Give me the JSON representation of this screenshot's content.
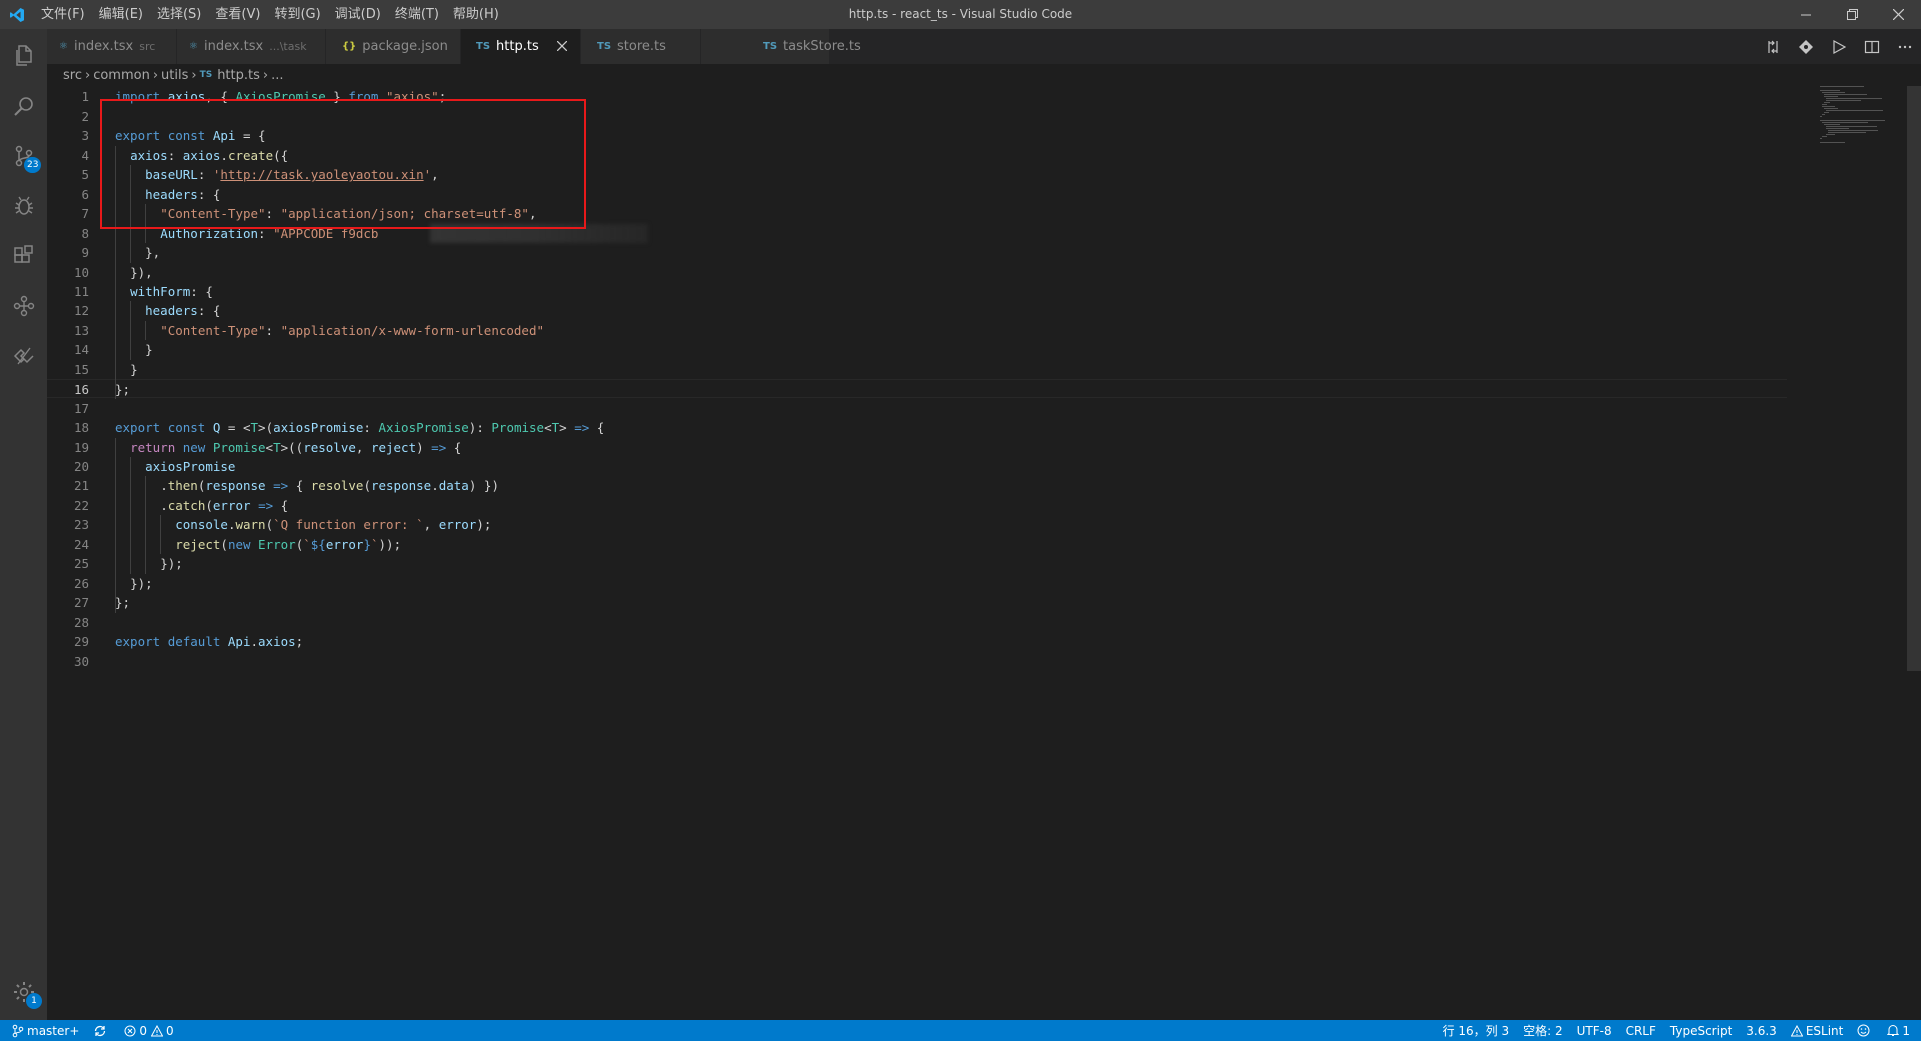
{
  "window": {
    "title": "http.ts - react_ts - Visual Studio Code"
  },
  "menubar": {
    "items": [
      "文件(F)",
      "编辑(E)",
      "选择(S)",
      "查看(V)",
      "转到(G)",
      "调试(D)",
      "终端(T)",
      "帮助(H)"
    ]
  },
  "activity_bar": {
    "scm_badge": "23",
    "settings_badge": "1"
  },
  "tabs": [
    {
      "label": "index.tsx",
      "description": "src",
      "icon": "react-icon",
      "active": false
    },
    {
      "label": "index.tsx",
      "description": "...\\task",
      "icon": "react-icon",
      "active": false
    },
    {
      "label": "package.json",
      "description": "",
      "icon": "json-icon",
      "active": false
    },
    {
      "label": "http.ts",
      "description": "",
      "icon": "ts-icon",
      "active": true
    },
    {
      "label": "store.ts",
      "description": "",
      "icon": "ts-icon",
      "active": false
    },
    {
      "label": "taskStore.ts",
      "description": "",
      "icon": "ts-icon",
      "active": false
    }
  ],
  "tab_icons": {
    "ts": "TS",
    "json": "{}",
    "react": "⚛"
  },
  "breadcrumb": {
    "segments": [
      "src",
      "common",
      "utils"
    ],
    "file": "http.ts",
    "trail": "..."
  },
  "editor": {
    "current_line": 16,
    "lines": [
      {
        "n": "1",
        "code": "import axios, { AxiosPromise } from \"axios\";"
      },
      {
        "n": "2",
        "code": ""
      },
      {
        "n": "3",
        "code": "export const Api = {"
      },
      {
        "n": "4",
        "code": "  axios: axios.create({"
      },
      {
        "n": "5",
        "code": "    baseURL: 'http://task.yaoleyaotou.xin',"
      },
      {
        "n": "6",
        "code": "    headers: {"
      },
      {
        "n": "7",
        "code": "      \"Content-Type\": \"application/json; charset=utf-8\","
      },
      {
        "n": "8",
        "code": "      Authorization: \"APPCODE f9dcb"
      },
      {
        "n": "9",
        "code": "    },"
      },
      {
        "n": "10",
        "code": "  }),"
      },
      {
        "n": "11",
        "code": "  withForm: {"
      },
      {
        "n": "12",
        "code": "    headers: {"
      },
      {
        "n": "13",
        "code": "      \"Content-Type\": \"application/x-www-form-urlencoded\""
      },
      {
        "n": "14",
        "code": "    }"
      },
      {
        "n": "15",
        "code": "  }"
      },
      {
        "n": "16",
        "code": "};"
      },
      {
        "n": "17",
        "code": ""
      },
      {
        "n": "18",
        "code": "export const Q = <T>(axiosPromise: AxiosPromise): Promise<T> => {"
      },
      {
        "n": "19",
        "code": "  return new Promise<T>((resolve, reject) => {"
      },
      {
        "n": "20",
        "code": "    axiosPromise"
      },
      {
        "n": "21",
        "code": "      .then(response => { resolve(response.data) })"
      },
      {
        "n": "22",
        "code": "      .catch(error => {"
      },
      {
        "n": "23",
        "code": "        console.warn(`Q function error: `, error);"
      },
      {
        "n": "24",
        "code": "        reject(new Error(`${error}`));"
      },
      {
        "n": "25",
        "code": "      });"
      },
      {
        "n": "26",
        "code": "  });"
      },
      {
        "n": "27",
        "code": "};"
      },
      {
        "n": "28",
        "code": ""
      },
      {
        "n": "29",
        "code": "export default Api.axios;"
      },
      {
        "n": "30",
        "code": ""
      }
    ]
  },
  "statusbar": {
    "branch": "master+",
    "errors": "0",
    "warnings": "0",
    "position": "行 16，列 3",
    "spaces": "空格: 2",
    "encoding": "UTF-8",
    "eol": "CRLF",
    "language": "TypeScript",
    "ts_version": "3.6.3",
    "linter": "ESLint",
    "notifications": "1"
  },
  "colors": {
    "accent": "#007acc",
    "highlight_box": "#e8191a",
    "keyword": "#569cd6",
    "string": "#ce9178",
    "property": "#9cdcfe",
    "type": "#4ec9b0",
    "function": "#dcdcaa"
  }
}
